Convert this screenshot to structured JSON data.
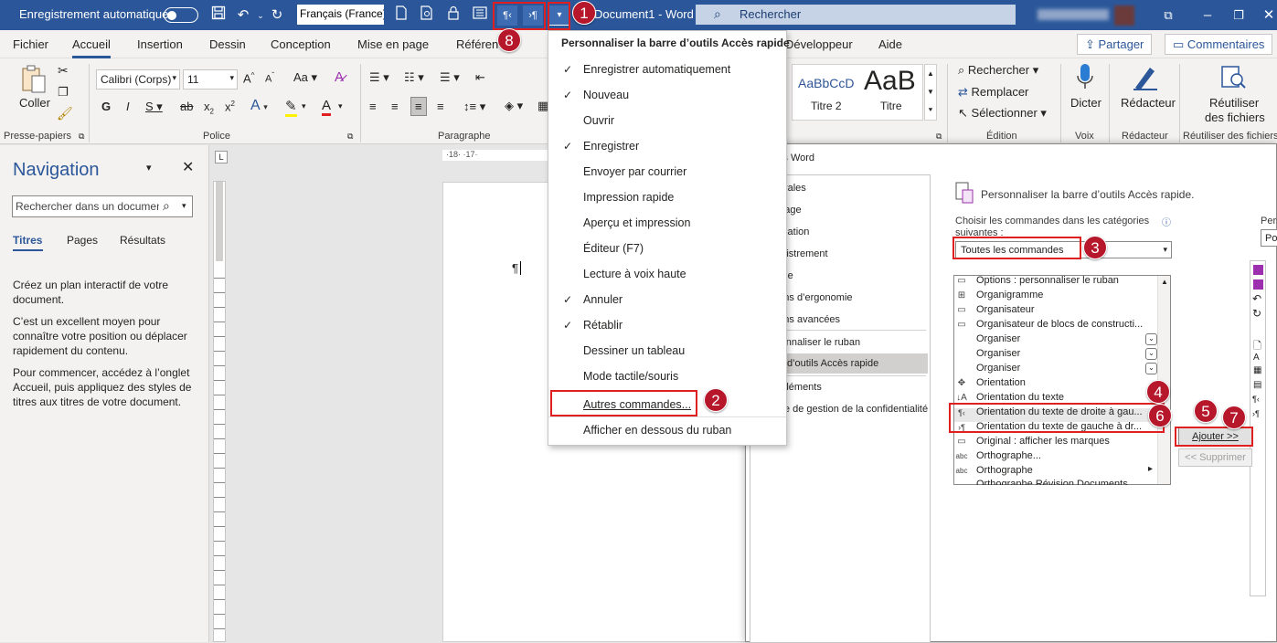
{
  "titlebar": {
    "autosave_label": "Enregistrement automatique",
    "language": "Français (France)",
    "doc_title": "Document1 - Word",
    "search_placeholder": "Rechercher",
    "bg_color": "#2b579a"
  },
  "tabs": [
    "Fichier",
    "Accueil",
    "Insertion",
    "Dessin",
    "Conception",
    "Mise en page",
    "Référen",
    "Développeur",
    "Aide"
  ],
  "share_label": "Partager",
  "comments_label": "Commentaires",
  "ribbon": {
    "paste_label": "Coller",
    "clipboard_group": "Presse-papiers",
    "font_name": "Calibri (Corps)",
    "font_size": "11",
    "font_group": "Police",
    "paragraph_group": "Paragraphe",
    "style1_preview": "AaBbCcD",
    "style1_name": "Titre 2",
    "style2_preview": "AaB",
    "style2_name": "Titre",
    "find_label": "Rechercher",
    "replace_label": "Remplacer",
    "select_label": "Sélectionner",
    "editing_group": "Édition",
    "dictate_label": "Dicter",
    "voice_group": "Voix",
    "editor_label": "Rédacteur",
    "editor_group": "Rédacteur",
    "reuse_label1": "Réutiliser",
    "reuse_label2": "des fichiers",
    "reuse_group": "Réutiliser des fichiers",
    "ruler_text": "·18· ·17·"
  },
  "navigation": {
    "title": "Navigation",
    "search_placeholder": "Rechercher dans un document",
    "tabs": [
      "Titres",
      "Pages",
      "Résultats"
    ],
    "para1_line1": "Créez un plan interactif de votre",
    "para1_line2": "document.",
    "para2_line1": "C’est un excellent moyen pour",
    "para2_line2": "connaître votre position ou déplacer",
    "para2_line3": "rapidement du contenu.",
    "para3_line1": "Pour commencer, accédez à l’onglet",
    "para3_line2": "Accueil, puis appliquez des styles de",
    "para3_line3": "titres aux titres de votre document."
  },
  "document": {
    "pilcrow": "¶"
  },
  "qat_menu": {
    "title": "Personnaliser la barre d’outils Accès rapide",
    "items": [
      {
        "label": "Enregistrer automatiquement",
        "checked": "✓"
      },
      {
        "label": "Nouveau",
        "checked": "✓"
      },
      {
        "label": "Ouvrir",
        "checked": ""
      },
      {
        "label": "Enregistrer",
        "checked": "✓"
      },
      {
        "label": "Envoyer par courrier",
        "checked": ""
      },
      {
        "label": "Impression rapide",
        "checked": ""
      },
      {
        "label": "Aperçu et impression",
        "checked": ""
      },
      {
        "label": "Éditeur (F7)",
        "checked": ""
      },
      {
        "label": "Lecture à voix haute",
        "checked": ""
      },
      {
        "label": "Annuler",
        "checked": "✓"
      },
      {
        "label": "Rétablir",
        "checked": "✓"
      },
      {
        "label": "Dessiner un tableau",
        "checked": ""
      },
      {
        "label": "Mode tactile/souris",
        "checked": ""
      },
      {
        "label": "Autres commandes...",
        "checked": ""
      },
      {
        "label": "Afficher en dessous du ruban",
        "checked": ""
      }
    ]
  },
  "dialog": {
    "title": "Options Word",
    "sidebar": [
      "Générales",
      "Affichage",
      "Vérification",
      "Enregistrement",
      "Langue",
      "Options d’ergonomie",
      "Options avancées",
      "Personnaliser le ruban",
      "Barre d’outils Accès rapide",
      "Compléments",
      "Centre de gestion de la confidentialité"
    ],
    "heading": "Personnaliser la barre d’outils Accès rapide.",
    "choose_label_line1": "Choisir les commandes dans les catégories",
    "choose_label_line2": "suivantes :",
    "category_value": "Toutes les commandes",
    "right_label": "Pers",
    "right_value": "Po",
    "commands": [
      "Options : personnaliser le ruban",
      "Organigramme",
      "Organisateur",
      "Organisateur de blocs de constructi...",
      "Organiser",
      "Organiser",
      "Organiser",
      "Orientation",
      "Orientation du texte",
      "Orientation du texte de droite à gau...",
      "Orientation du texte de gauche à dr...",
      "Original : afficher les marques",
      "Orthographe...",
      "Orthographe",
      "Orthographe Révision Documents..."
    ],
    "add_button": "Ajouter >>",
    "remove_button": "<< Supprimer"
  },
  "badges": [
    "1",
    "2",
    "3",
    "4",
    "5",
    "6",
    "7",
    "8"
  ],
  "colors": {
    "accent": "#2b579a",
    "badge": "#b7172b",
    "highlight_box": "#e02020"
  }
}
